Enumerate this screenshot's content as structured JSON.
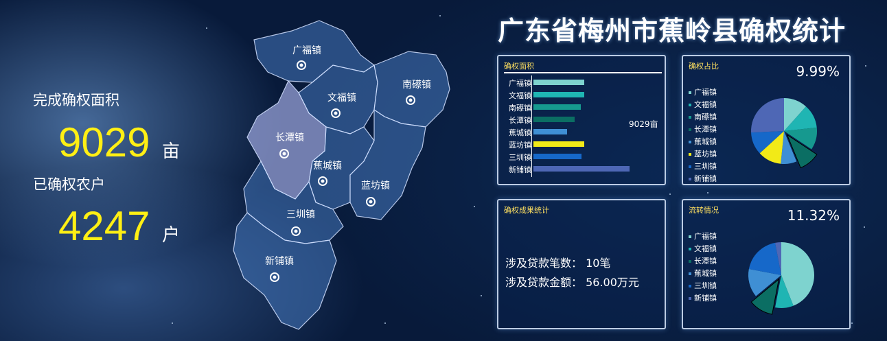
{
  "header": {
    "title": "广东省梅州市蕉岭县确权统计"
  },
  "stats": {
    "area_label": "完成确权面积",
    "area_value": "9029",
    "area_unit": "亩",
    "households_label": "已确权农户",
    "households_value": "4247",
    "households_unit": "户"
  },
  "map": {
    "towns": [
      {
        "name": "广福镇"
      },
      {
        "name": "文福镇"
      },
      {
        "name": "南礤镇"
      },
      {
        "name": "长潭镇"
      },
      {
        "name": "蕉城镇"
      },
      {
        "name": "蓝坊镇"
      },
      {
        "name": "三圳镇"
      },
      {
        "name": "新铺镇"
      }
    ]
  },
  "area_panel": {
    "title": "确权面积",
    "annotation": "9029亩",
    "chart_data": {
      "type": "bar",
      "categories": [
        "广福镇",
        "文福镇",
        "南礤镇",
        "长潭镇",
        "蕉城镇",
        "蓝坊镇",
        "三圳镇",
        "新铺镇"
      ],
      "values": [
        1050,
        1060,
        990,
        860,
        700,
        1050,
        1000,
        2000
      ],
      "colors": [
        "#7ed3cf",
        "#1fb5b3",
        "#16998f",
        "#0b6e63",
        "#3f8fd4",
        "#f2ea17",
        "#1668c9",
        "#4e67b5"
      ]
    }
  },
  "ratio_panel": {
    "title": "确权占比",
    "percent": "9.99%",
    "legend": [
      "广福镇",
      "文福镇",
      "南礤镇",
      "长潭镇",
      "蕉城镇",
      "蓝坊镇",
      "三圳镇",
      "新铺镇"
    ],
    "chart_data": {
      "type": "pie",
      "labels": [
        "广福镇",
        "文福镇",
        "南礤镇",
        "长潭镇",
        "蕉城镇",
        "蓝坊镇",
        "三圳镇",
        "新铺镇"
      ],
      "values": [
        11.6,
        11.7,
        11.0,
        9.5,
        7.8,
        11.6,
        11.1,
        25.7
      ],
      "colors": [
        "#7ed3cf",
        "#1fb5b3",
        "#16998f",
        "#0b6e63",
        "#3f8fd4",
        "#f2ea17",
        "#1668c9",
        "#4e67b5"
      ],
      "exploded_index": 3
    }
  },
  "loan_panel": {
    "title": "确权成果统计",
    "count_label": "涉及贷款笔数：",
    "count_value": "10笔",
    "amount_label": "涉及贷款金额：",
    "amount_value": "56.00万元"
  },
  "transfer_panel": {
    "title": "流转情况",
    "percent": "11.32%",
    "legend": [
      "广福镇",
      "文福镇",
      "长潭镇",
      "蕉城镇",
      "三圳镇",
      "新铺镇"
    ],
    "chart_data": {
      "type": "pie",
      "labels": [
        "广福镇",
        "文福镇",
        "长潭镇",
        "蕉城镇",
        "三圳镇",
        "新铺镇"
      ],
      "values": [
        44,
        9,
        11,
        14,
        19,
        3
      ],
      "colors": [
        "#7ed3cf",
        "#1fb5b3",
        "#0b6e63",
        "#3f8fd4",
        "#1668c9",
        "#4e67b5"
      ],
      "exploded_index": 2
    }
  }
}
